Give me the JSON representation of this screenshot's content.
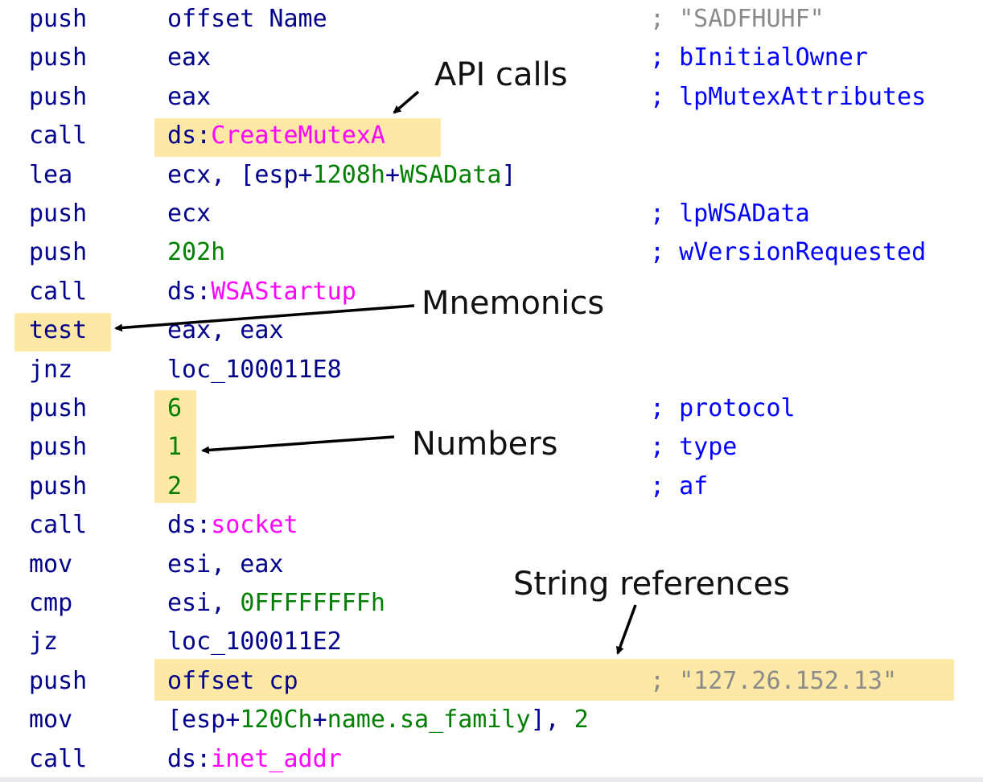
{
  "listing": [
    {
      "mnemonic": "push",
      "operand": [
        {
          "t": "offset Name",
          "c": "txt"
        }
      ],
      "comment": "; \"SADFHUHF\"",
      "comment_color": "#8b8b8b"
    },
    {
      "mnemonic": "push",
      "operand": [
        {
          "t": "eax",
          "c": "txt"
        }
      ],
      "comment": "; bInitialOwner"
    },
    {
      "mnemonic": "push",
      "operand": [
        {
          "t": "eax",
          "c": "txt"
        }
      ],
      "comment": "; lpMutexAttributes"
    },
    {
      "mnemonic": "call",
      "operand": [
        {
          "t": "ds:",
          "c": "txt"
        },
        {
          "t": "CreateMutexA",
          "c": "api"
        }
      ],
      "comment": ""
    },
    {
      "mnemonic": "lea",
      "operand": [
        {
          "t": "ecx, [esp+",
          "c": "txt"
        },
        {
          "t": "1208h",
          "c": "num"
        },
        {
          "t": "+",
          "c": "txt"
        },
        {
          "t": "WSAData",
          "c": "num"
        },
        {
          "t": "]",
          "c": "txt"
        }
      ],
      "comment": ""
    },
    {
      "mnemonic": "push",
      "operand": [
        {
          "t": "ecx",
          "c": "txt"
        }
      ],
      "comment": "; lpWSAData"
    },
    {
      "mnemonic": "push",
      "operand": [
        {
          "t": "202h",
          "c": "num"
        }
      ],
      "comment": "; wVersionRequested"
    },
    {
      "mnemonic": "call",
      "operand": [
        {
          "t": "ds:",
          "c": "txt"
        },
        {
          "t": "WSAStartup",
          "c": "api"
        }
      ],
      "comment": ""
    },
    {
      "mnemonic": "test",
      "operand": [
        {
          "t": "eax, eax",
          "c": "txt"
        }
      ],
      "comment": ""
    },
    {
      "mnemonic": "jnz",
      "operand": [
        {
          "t": "loc_100011E8",
          "c": "txt"
        }
      ],
      "comment": ""
    },
    {
      "mnemonic": "push",
      "operand": [
        {
          "t": "6",
          "c": "num"
        }
      ],
      "comment": "; protocol"
    },
    {
      "mnemonic": "push",
      "operand": [
        {
          "t": "1",
          "c": "num"
        }
      ],
      "comment": "; type"
    },
    {
      "mnemonic": "push",
      "operand": [
        {
          "t": "2",
          "c": "num"
        }
      ],
      "comment": "; af"
    },
    {
      "mnemonic": "call",
      "operand": [
        {
          "t": "ds:",
          "c": "txt"
        },
        {
          "t": "socket",
          "c": "api"
        }
      ],
      "comment": ""
    },
    {
      "mnemonic": "mov",
      "operand": [
        {
          "t": "esi, eax",
          "c": "txt"
        }
      ],
      "comment": ""
    },
    {
      "mnemonic": "cmp",
      "operand": [
        {
          "t": "esi, ",
          "c": "txt"
        },
        {
          "t": "0FFFFFFFFh",
          "c": "num"
        }
      ],
      "comment": ""
    },
    {
      "mnemonic": "jz",
      "operand": [
        {
          "t": "loc_100011E2",
          "c": "txt"
        }
      ],
      "comment": ""
    },
    {
      "mnemonic": "push",
      "operand": [
        {
          "t": "offset cp",
          "c": "txt"
        }
      ],
      "comment": "; \"127.26.152.13\"",
      "comment_color": "#8b8b8b"
    },
    {
      "mnemonic": "mov",
      "operand": [
        {
          "t": "[esp+",
          "c": "txt"
        },
        {
          "t": "120Ch",
          "c": "num"
        },
        {
          "t": "+",
          "c": "txt"
        },
        {
          "t": "name.sa_family",
          "c": "num"
        },
        {
          "t": "], ",
          "c": "txt"
        },
        {
          "t": "2",
          "c": "num"
        }
      ],
      "comment": ""
    },
    {
      "mnemonic": "call",
      "operand": [
        {
          "t": "ds:",
          "c": "txt"
        },
        {
          "t": "inet_addr",
          "c": "api"
        }
      ],
      "comment": ""
    }
  ],
  "annotations": {
    "api_calls": "API calls",
    "mnemonics": "Mnemonics",
    "numbers": "Numbers",
    "string_references": "String references"
  },
  "colors": {
    "mnemonic": "#00008b",
    "comment": "#0000ff",
    "string_comment": "#8b8b8b",
    "number": "#008000",
    "api": "#ff00ff",
    "highlight": "#fde59a"
  }
}
